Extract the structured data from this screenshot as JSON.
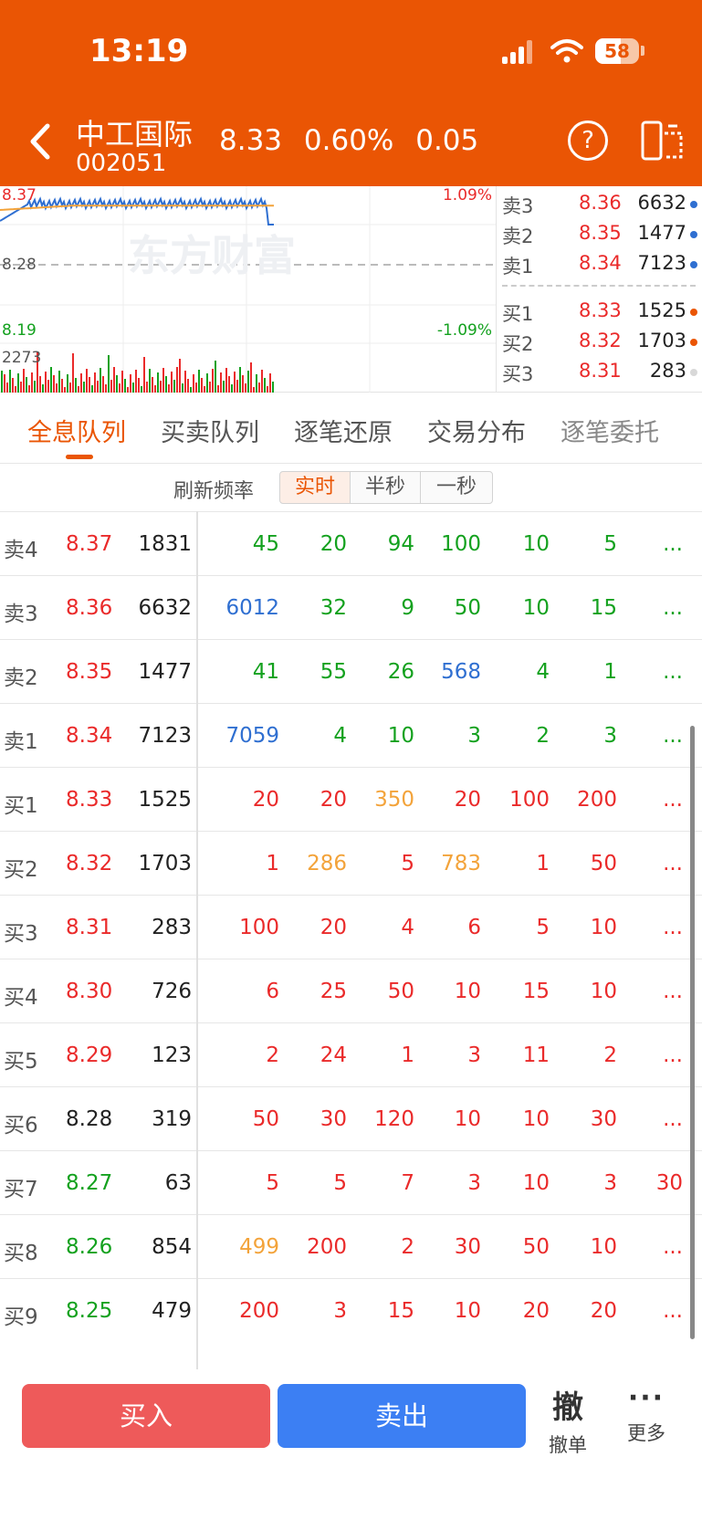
{
  "status_bar": {
    "time": "13:19",
    "battery": "58",
    "battery_level": 0.58
  },
  "header": {
    "stock_name": "中工国际",
    "stock_code": "002051",
    "price": "8.33",
    "change_pct": "0.60%",
    "change": "0.05"
  },
  "chart": {
    "high_price": "8.37",
    "mid_price": "8.28",
    "low_price": "8.19",
    "high_pct": "1.09%",
    "low_pct": "-1.09%",
    "volume_label": "2273",
    "watermark": "东方财富",
    "colors": {
      "line": "#2f6fd1",
      "avg": "#f3a33a",
      "up": "#ea2a2a",
      "down": "#13a11e"
    }
  },
  "depth": {
    "asks": [
      {
        "label": "卖3",
        "price": "8.36",
        "vol": "6632"
      },
      {
        "label": "卖2",
        "price": "8.35",
        "vol": "1477"
      },
      {
        "label": "卖1",
        "price": "8.34",
        "vol": "7123"
      }
    ],
    "bids": [
      {
        "label": "买1",
        "price": "8.33",
        "vol": "1525"
      },
      {
        "label": "买2",
        "price": "8.32",
        "vol": "1703"
      },
      {
        "label": "买3",
        "price": "8.31",
        "vol": "283"
      }
    ]
  },
  "tabs": [
    "全息队列",
    "买卖队列",
    "逐笔还原",
    "交易分布",
    "逐笔委托"
  ],
  "refresh": {
    "label": "刷新频率",
    "options": [
      "实时",
      "半秒",
      "一秒"
    ]
  },
  "queue": [
    {
      "level": "卖4",
      "price": "8.37",
      "vol": "1831",
      "orders": [
        "45",
        "20",
        "94",
        "100",
        "10",
        "5",
        "..."
      ]
    },
    {
      "level": "卖3",
      "price": "8.36",
      "vol": "6632",
      "orders": [
        "6012",
        "32",
        "9",
        "50",
        "10",
        "15",
        "..."
      ]
    },
    {
      "level": "卖2",
      "price": "8.35",
      "vol": "1477",
      "orders": [
        "41",
        "55",
        "26",
        "568",
        "4",
        "1",
        "..."
      ]
    },
    {
      "level": "卖1",
      "price": "8.34",
      "vol": "7123",
      "orders": [
        "7059",
        "4",
        "10",
        "3",
        "2",
        "3",
        "..."
      ]
    },
    {
      "level": "买1",
      "price": "8.33",
      "vol": "1525",
      "orders": [
        "20",
        "20",
        "350",
        "20",
        "100",
        "200",
        "..."
      ]
    },
    {
      "level": "买2",
      "price": "8.32",
      "vol": "1703",
      "orders": [
        "1",
        "286",
        "5",
        "783",
        "1",
        "50",
        "..."
      ]
    },
    {
      "level": "买3",
      "price": "8.31",
      "vol": "283",
      "orders": [
        "100",
        "20",
        "4",
        "6",
        "5",
        "10",
        "..."
      ]
    },
    {
      "level": "买4",
      "price": "8.30",
      "vol": "726",
      "orders": [
        "6",
        "25",
        "50",
        "10",
        "15",
        "10",
        "..."
      ]
    },
    {
      "level": "买5",
      "price": "8.29",
      "vol": "123",
      "orders": [
        "2",
        "24",
        "1",
        "3",
        "11",
        "2",
        "..."
      ]
    },
    {
      "level": "买6",
      "price": "8.28",
      "vol": "319",
      "orders": [
        "50",
        "30",
        "120",
        "10",
        "10",
        "30",
        "..."
      ]
    },
    {
      "level": "买7",
      "price": "8.27",
      "vol": "63",
      "orders": [
        "5",
        "5",
        "7",
        "3",
        "10",
        "3",
        "30"
      ]
    },
    {
      "level": "买8",
      "price": "8.26",
      "vol": "854",
      "orders": [
        "499",
        "200",
        "2",
        "30",
        "50",
        "10",
        "..."
      ]
    },
    {
      "level": "买9",
      "price": "8.25",
      "vol": "479",
      "orders": [
        "200",
        "3",
        "15",
        "10",
        "20",
        "20",
        "..."
      ]
    }
  ],
  "bottom": {
    "buy": "买入",
    "sell": "卖出",
    "cancel_icon": "撤",
    "cancel": "撤单",
    "more_icon": "···",
    "more": "更多"
  }
}
